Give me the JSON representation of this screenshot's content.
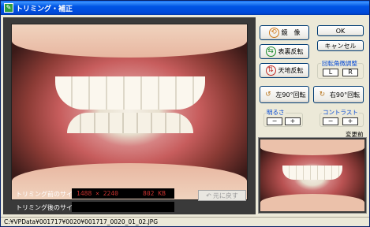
{
  "window": {
    "title": "トリミング・補正"
  },
  "info": {
    "before_label": "トリミング前のサイズ:",
    "before_dims": "1488 × 2240",
    "before_size": "802 KB",
    "after_label": "トリミング後のサイズ:",
    "after_value": ""
  },
  "buttons": {
    "undo": "元に戻す",
    "mirror": "鏡　像",
    "flip_horizontal": "表裏反転",
    "flip_vertical": "天地反転",
    "rotate_left": "左90°回転",
    "rotate_right": "右90°回転",
    "ok": "OK",
    "cancel": "キャンセル"
  },
  "rotation_fine": {
    "label": "回転角微調整",
    "left": "L",
    "right": "R"
  },
  "brightness": {
    "label": "明るさ",
    "minus": "−",
    "plus": "+"
  },
  "contrast": {
    "label": "コントラスト",
    "minus": "−",
    "plus": "+"
  },
  "preview": {
    "label": "変更前"
  },
  "status": {
    "path": "C:¥VPData¥001717¥0020¥001717_0020_01_02.JPG"
  },
  "colors": {
    "title_bar": "#0054e3",
    "panel_bg": "#3a3a3a",
    "group_label": "#0046d5",
    "size_text": "#c8322f"
  },
  "icons": {
    "mirror": "mirror-icon",
    "flip_horizontal": "flip-horizontal-icon",
    "flip_vertical": "flip-vertical-icon",
    "rotate_left": "rotate-left-icon",
    "rotate_right": "rotate-right-icon"
  }
}
